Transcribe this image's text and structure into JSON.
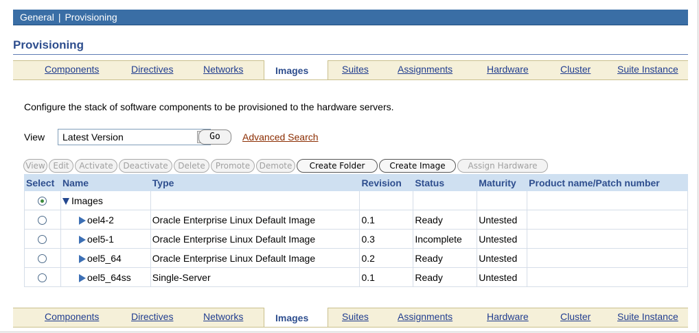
{
  "header": {
    "breadcrumb_1": "General",
    "separator": "|",
    "breadcrumb_2": "Provisioning"
  },
  "page": {
    "title": "Provisioning",
    "description": "Configure the stack of software components to be provisioned to the hardware servers."
  },
  "tabs": {
    "items": [
      "Components",
      "Directives",
      "Networks",
      "Images",
      "Suites",
      "Assignments",
      "Hardware",
      "Cluster",
      "Suite Instance"
    ],
    "active": "Images"
  },
  "view": {
    "label": "View",
    "selected": "Latest Version",
    "go": "Go",
    "advanced_search": "Advanced Search"
  },
  "toolbar": {
    "view": "View",
    "edit": "Edit",
    "activate": "Activate",
    "deactivate": "Deactivate",
    "delete": "Delete",
    "promote": "Promote",
    "demote": "Demote",
    "create_folder": "Create Folder",
    "create_image": "Create Image",
    "assign_hardware": "Assign Hardware"
  },
  "table": {
    "headers": [
      "Select",
      "Name",
      "Type",
      "Revision",
      "Status",
      "Maturity",
      "Product name/Patch number"
    ],
    "rows": [
      {
        "name": "Images",
        "type": "",
        "revision": "",
        "status": "",
        "maturity": "",
        "product": "",
        "selected": true,
        "folder": true
      },
      {
        "name": "oel4-2",
        "type": "Oracle Enterprise Linux Default Image",
        "revision": "0.1",
        "status": "Ready",
        "maturity": "Untested",
        "product": "",
        "selected": false,
        "folder": false
      },
      {
        "name": "oel5-1",
        "type": "Oracle Enterprise Linux Default Image",
        "revision": "0.3",
        "status": "Incomplete",
        "maturity": "Untested",
        "product": "",
        "selected": false,
        "folder": false
      },
      {
        "name": "oel5_64",
        "type": "Oracle Enterprise Linux Default Image",
        "revision": "0.2",
        "status": "Ready",
        "maturity": "Untested",
        "product": "",
        "selected": false,
        "folder": false
      },
      {
        "name": "oel5_64ss",
        "type": "Single-Server",
        "revision": "0.1",
        "status": "Ready",
        "maturity": "Untested",
        "product": "",
        "selected": false,
        "folder": false
      }
    ]
  },
  "colors": {
    "header_bar": "#3a6ea5",
    "title": "#2e4e8e",
    "tab_band": "#f5f0d9",
    "table_header": "#cfe0f1",
    "link": "#1f3c8f",
    "advanced_link": "#8b2c00"
  }
}
